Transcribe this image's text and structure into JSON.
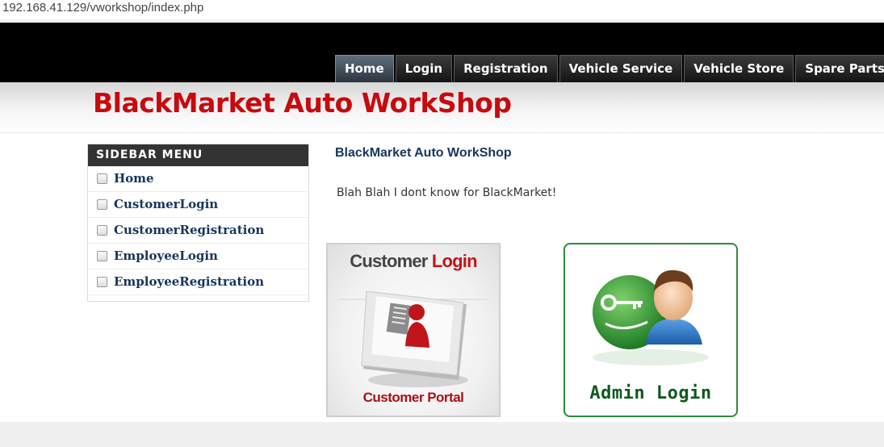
{
  "browser": {
    "url": "192.168.41.129/vworkshop/index.php"
  },
  "nav": {
    "items": [
      {
        "label": "Home",
        "active": true
      },
      {
        "label": "Login"
      },
      {
        "label": "Registration"
      },
      {
        "label": "Vehicle Service"
      },
      {
        "label": "Vehicle Store"
      },
      {
        "label": "Spare Parts"
      }
    ]
  },
  "header": {
    "title": "BlackMarket Auto WorkShop"
  },
  "sidebar": {
    "title": "SIDEBAR MENU",
    "items": [
      {
        "label": "Home"
      },
      {
        "label": "CustomerLogin"
      },
      {
        "label": "CustomerRegistration"
      },
      {
        "label": "EmployeeLogin"
      },
      {
        "label": "EmployeeRegistration"
      }
    ]
  },
  "main": {
    "title": "BlackMarket Auto WorkShop",
    "text": "Blah Blah I dont know for BlackMarket!"
  },
  "cards": {
    "customer": {
      "heading_part1": "Customer",
      "heading_part2": "Login",
      "footer": "Customer Portal"
    },
    "admin": {
      "label": "Admin Login"
    }
  },
  "colors": {
    "brand_red": "#c8090d",
    "link_navy": "#16355c",
    "admin_green": "#2e8b3a"
  }
}
